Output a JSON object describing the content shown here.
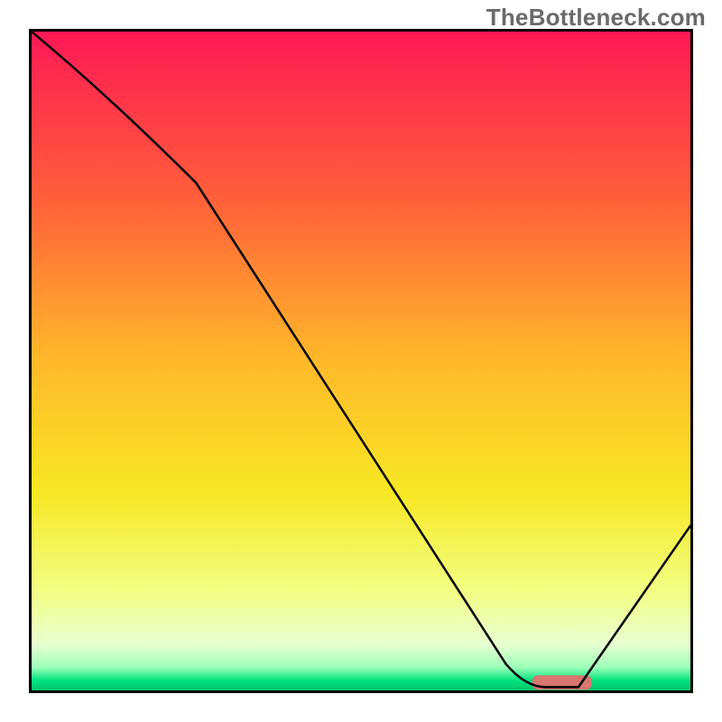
{
  "watermark": "TheBottleneck.com",
  "chart_data": {
    "type": "line",
    "title": "",
    "xlabel": "",
    "ylabel": "",
    "xlim": [
      0,
      100
    ],
    "ylim": [
      0,
      100
    ],
    "x": [
      0,
      25,
      72,
      78,
      83,
      100
    ],
    "values": [
      100,
      77,
      4,
      0.5,
      0.5,
      25
    ],
    "gradient_stops": [
      {
        "pos": 0.0,
        "color": "#ff1955"
      },
      {
        "pos": 0.25,
        "color": "#ff5e3a"
      },
      {
        "pos": 0.5,
        "color": "#ffb92a"
      },
      {
        "pos": 0.7,
        "color": "#f7e723"
      },
      {
        "pos": 0.85,
        "color": "#f2ff84"
      },
      {
        "pos": 0.93,
        "color": "#e8ffd1"
      },
      {
        "pos": 0.965,
        "color": "#9cffb8"
      },
      {
        "pos": 0.985,
        "color": "#00e27e"
      },
      {
        "pos": 1.0,
        "color": "#00c46a"
      }
    ],
    "marker": {
      "x_center": 80.5,
      "y": 1.2,
      "width": 9,
      "height": 2.2,
      "color": "#d8766f"
    },
    "curve_stroke": "#000000",
    "curve_width": 2.5
  }
}
